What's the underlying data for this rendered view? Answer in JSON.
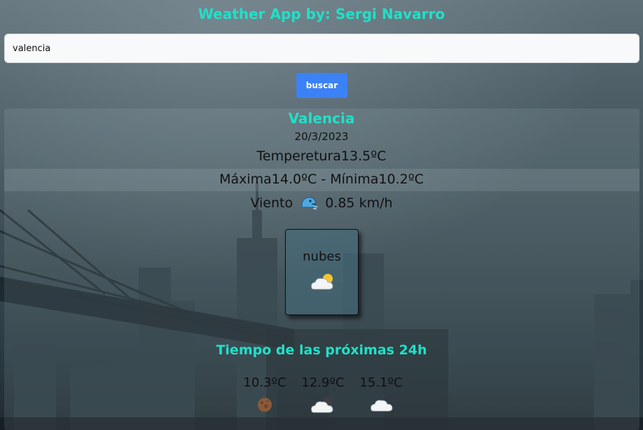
{
  "header": {
    "title": "Weather App by: Sergi Navarro"
  },
  "search": {
    "value": "valencia",
    "button_label": "buscar"
  },
  "current": {
    "city": "Valencia",
    "date": "20/3/2023",
    "temperature_text": "Temperetura13.5ºC",
    "minmax_text": "Máxima14.0ºC - Mínima10.2ºC",
    "wind_label": "Viento",
    "wind_icon": "wind-face-icon",
    "wind_value": "0.85 km/h",
    "condition": "nubes",
    "condition_icon": "sun-behind-cloud-icon"
  },
  "forecast": {
    "title": "Tiempo de las próximas 24h",
    "items": [
      {
        "temp": "10.3ºC",
        "icon": "moon-brown-icon"
      },
      {
        "temp": "12.9ºC",
        "icon": "moon-behind-cloud-icon"
      },
      {
        "temp": "15.1ºC",
        "icon": "cloud-icon"
      }
    ]
  },
  "colors": {
    "accent_teal": "#20e0c8",
    "button_blue": "#3b82f6",
    "text_dark": "#111111"
  }
}
